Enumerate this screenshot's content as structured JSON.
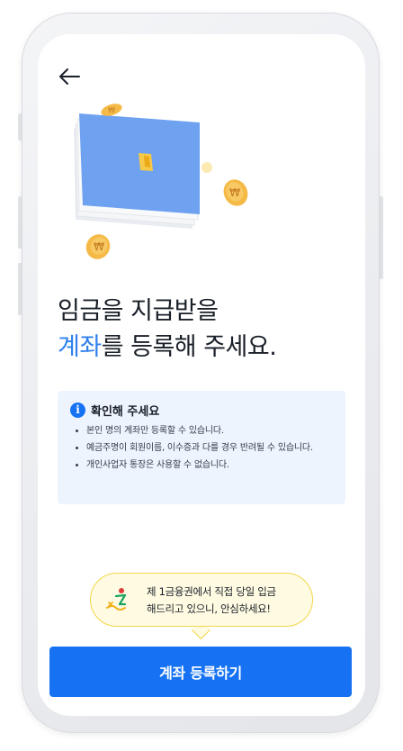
{
  "header": {
    "back_icon": "arrow-left-icon"
  },
  "hero": {
    "illustration": "card-with-coins",
    "coin_symbol": "₩"
  },
  "title": {
    "line1": "임금을 지급받을",
    "accent": "계좌",
    "line2_rest": "를 등록해 주세요."
  },
  "notice": {
    "icon": "info-icon",
    "icon_glyph": "i",
    "title": "확인해 주세요",
    "items": [
      "본인 명의 계좌만 등록할 수 있습니다.",
      "예금주명이 회원이름, 이수증과 다를 경우 반려될 수 있습니다.",
      "개인사업자 통장은 사용할 수 없습니다."
    ]
  },
  "bubble": {
    "logo": "bank-logo-icon",
    "line1": "제 1금융권에서 직접 당일 입금",
    "line2": "해드리고 있으니, 안심하세요!"
  },
  "cta": {
    "label": "계좌 등록하기"
  },
  "colors": {
    "accent": "#2f80ed",
    "button": "#1672f3",
    "notice_bg": "#eef4fd",
    "bubble_bg": "#fffbe2"
  }
}
